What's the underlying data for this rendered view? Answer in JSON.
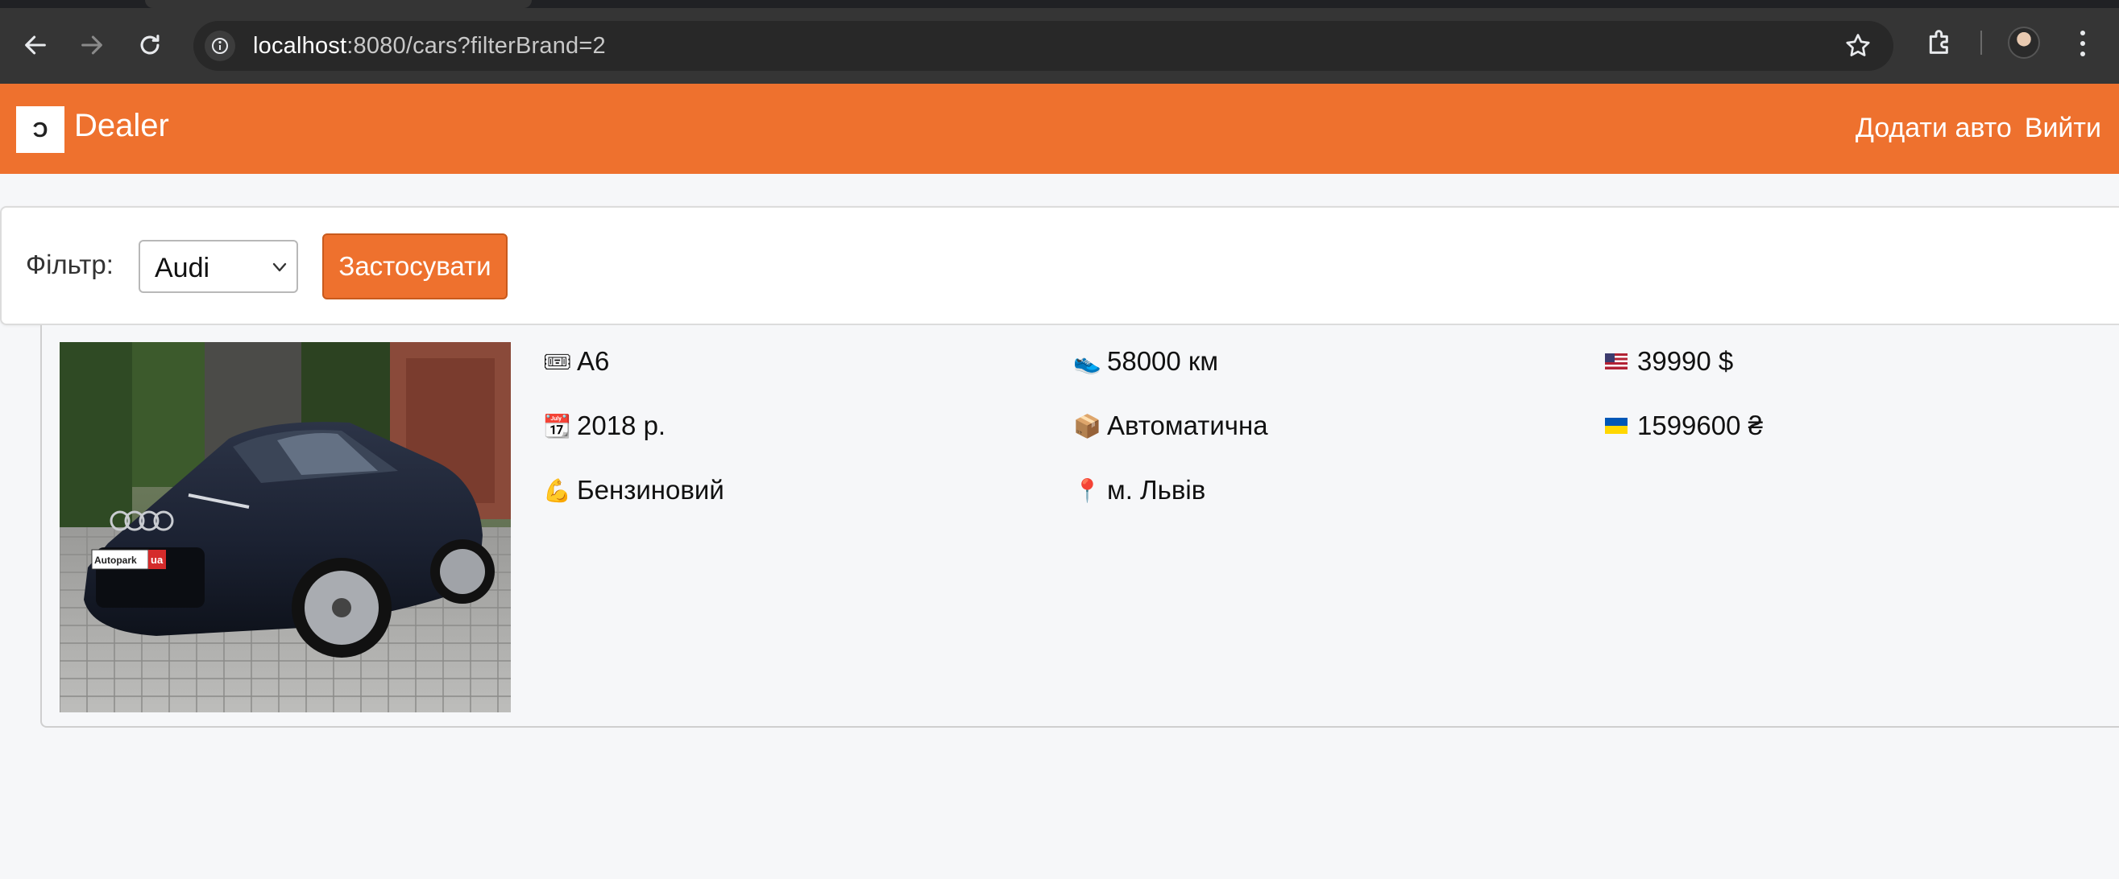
{
  "browser": {
    "url_host": "localhost",
    "url_rest": ":8080/cars?filterBrand=2"
  },
  "navbar": {
    "logo_glyph": "Ɔ",
    "brand": "Dealer",
    "links": [
      "Додати авто",
      "Вийти"
    ]
  },
  "filter": {
    "label": "Фільтр:",
    "selected_brand": "Audi",
    "apply_label": "Застосувати"
  },
  "car": {
    "model": "A6",
    "mileage": "58000 км",
    "price_usd": "39990 $",
    "year": "2018 р.",
    "transmission": "Автоматична",
    "price_uah": "1599600 ₴",
    "fuel": "Бензиновий",
    "location": "м. Львів",
    "plate_text": "Autopark",
    "plate_badge": "ua",
    "icons": {
      "model": "ticket-icon",
      "mileage": "shoe-icon",
      "price_usd": "us-flag-icon",
      "year": "calendar-icon",
      "transmission": "package-icon",
      "price_uah": "ua-flag-icon",
      "fuel": "muscle-icon",
      "location": "pin-icon"
    }
  },
  "colors": {
    "accent": "#ee712e",
    "page_bg": "#f6f7f9"
  }
}
